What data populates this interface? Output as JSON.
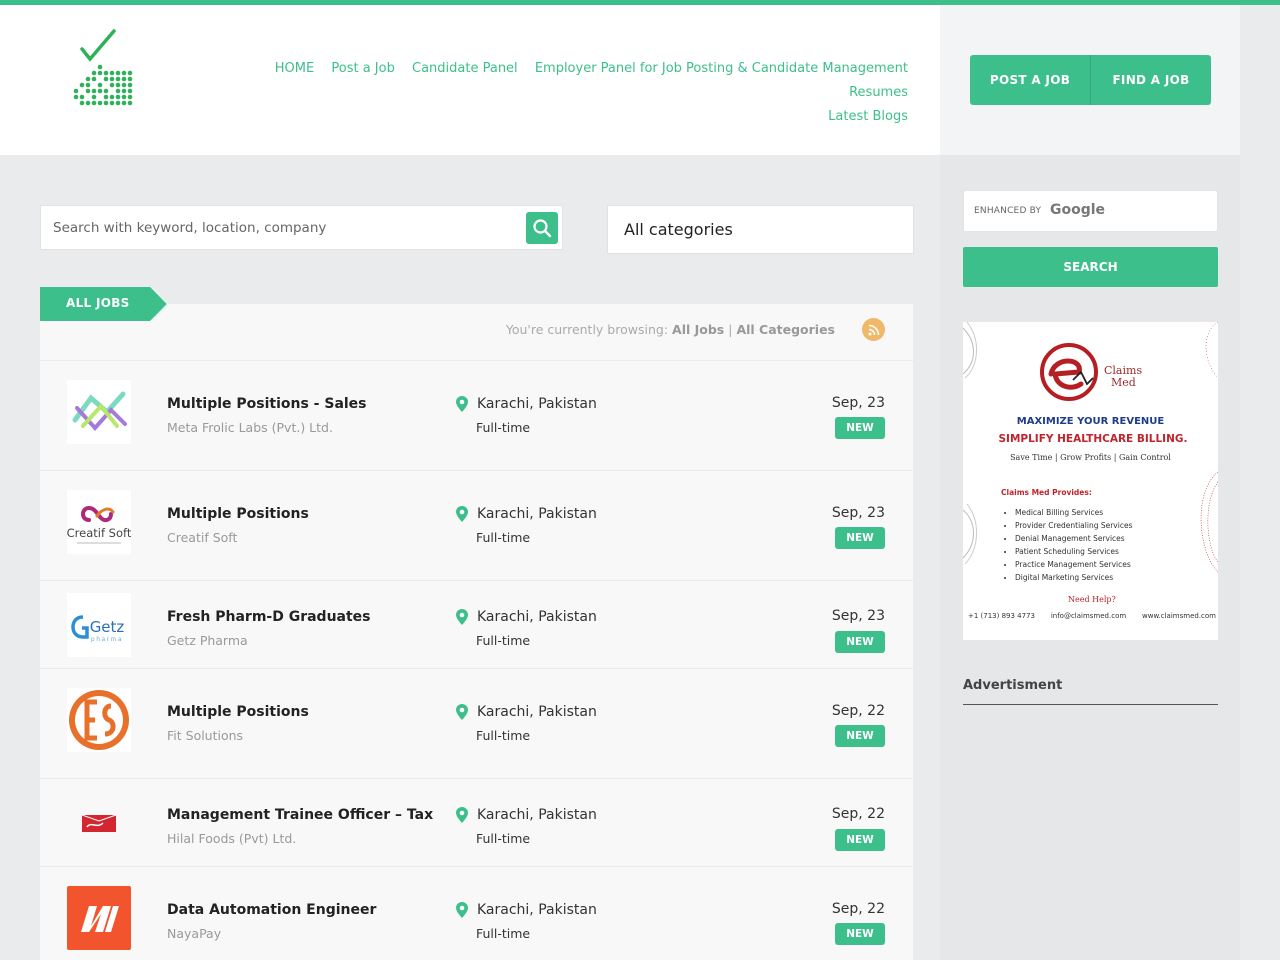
{
  "nav": {
    "items": [
      {
        "label": "HOME"
      },
      {
        "label": "Post a Job"
      },
      {
        "label": "Candidate Panel"
      },
      {
        "label": "Employer Panel for Job Posting & Candidate Management"
      },
      {
        "label": "Resumes"
      },
      {
        "label": "Latest Blogs"
      }
    ]
  },
  "header_buttons": {
    "post": "POST A JOB",
    "find": "FIND A JOB"
  },
  "search": {
    "placeholder": "Search with keyword, location, company",
    "category": "All categories"
  },
  "jobs_tab": "ALL JOBS",
  "browsing": {
    "prefix": "You're currently browsing:",
    "jobs": "All Jobs",
    "sep": "|",
    "cats": "All Categories"
  },
  "jobs": [
    {
      "title": "Multiple Positions - Sales",
      "company": "Meta Frolic Labs (Pvt.) Ltd.",
      "location": "Karachi, Pakistan",
      "type": "Full-time",
      "date": "Sep, 23",
      "badge": "NEW"
    },
    {
      "title": "Multiple Positions",
      "company": "Creatif Soft",
      "location": "Karachi, Pakistan",
      "type": "Full-time",
      "date": "Sep, 23",
      "badge": "NEW"
    },
    {
      "title": "Fresh Pharm-D Graduates",
      "company": "Getz Pharma",
      "location": "Karachi, Pakistan",
      "type": "Full-time",
      "date": "Sep, 23",
      "badge": "NEW"
    },
    {
      "title": "Multiple Positions",
      "company": "Fit Solutions",
      "location": "Karachi, Pakistan",
      "type": "Full-time",
      "date": "Sep, 22",
      "badge": "NEW"
    },
    {
      "title": "Management Trainee Officer – Tax",
      "company": "Hilal Foods (Pvt) Ltd.",
      "location": "Karachi, Pakistan",
      "type": "Full-time",
      "date": "Sep, 22",
      "badge": "NEW"
    },
    {
      "title": "Data Automation Engineer",
      "company": "NayaPay",
      "location": "Karachi, Pakistan",
      "type": "Full-time",
      "date": "Sep, 22",
      "badge": "NEW"
    }
  ],
  "logos": {
    "creatif": "Creatif Soft",
    "getz": "Getz",
    "getz_sub": "pharma"
  },
  "gsearch": {
    "enhanced": "ENHANCED BY",
    "google": "Google",
    "button": "SEARCH"
  },
  "ad": {
    "brand1": "Claims",
    "brand2": "Med",
    "h1": "MAXIMIZE YOUR REVENUE",
    "h2": "SIMPLIFY HEALTHCARE BILLING.",
    "h3": "Save Time | Grow Profits | Gain Control",
    "provides": "Claims Med Provides:",
    "services": [
      "Medical Billing Services",
      "Provider Credentialing Services",
      "Denial Management Services",
      "Patient Scheduling Services",
      "Practice Management Services",
      "Digital Marketing Services"
    ],
    "need": "Need Help?",
    "phone": "+1 (713) 893 4773",
    "email": "info@claimsmed.com",
    "web": "www.claimsmed.com"
  },
  "advertisment_label": "Advertisment",
  "colors": {
    "accent": "#3dbf8c",
    "rss": "#f1b86a",
    "ad_red": "#c0242c",
    "ad_blue": "#1e3c8a"
  }
}
